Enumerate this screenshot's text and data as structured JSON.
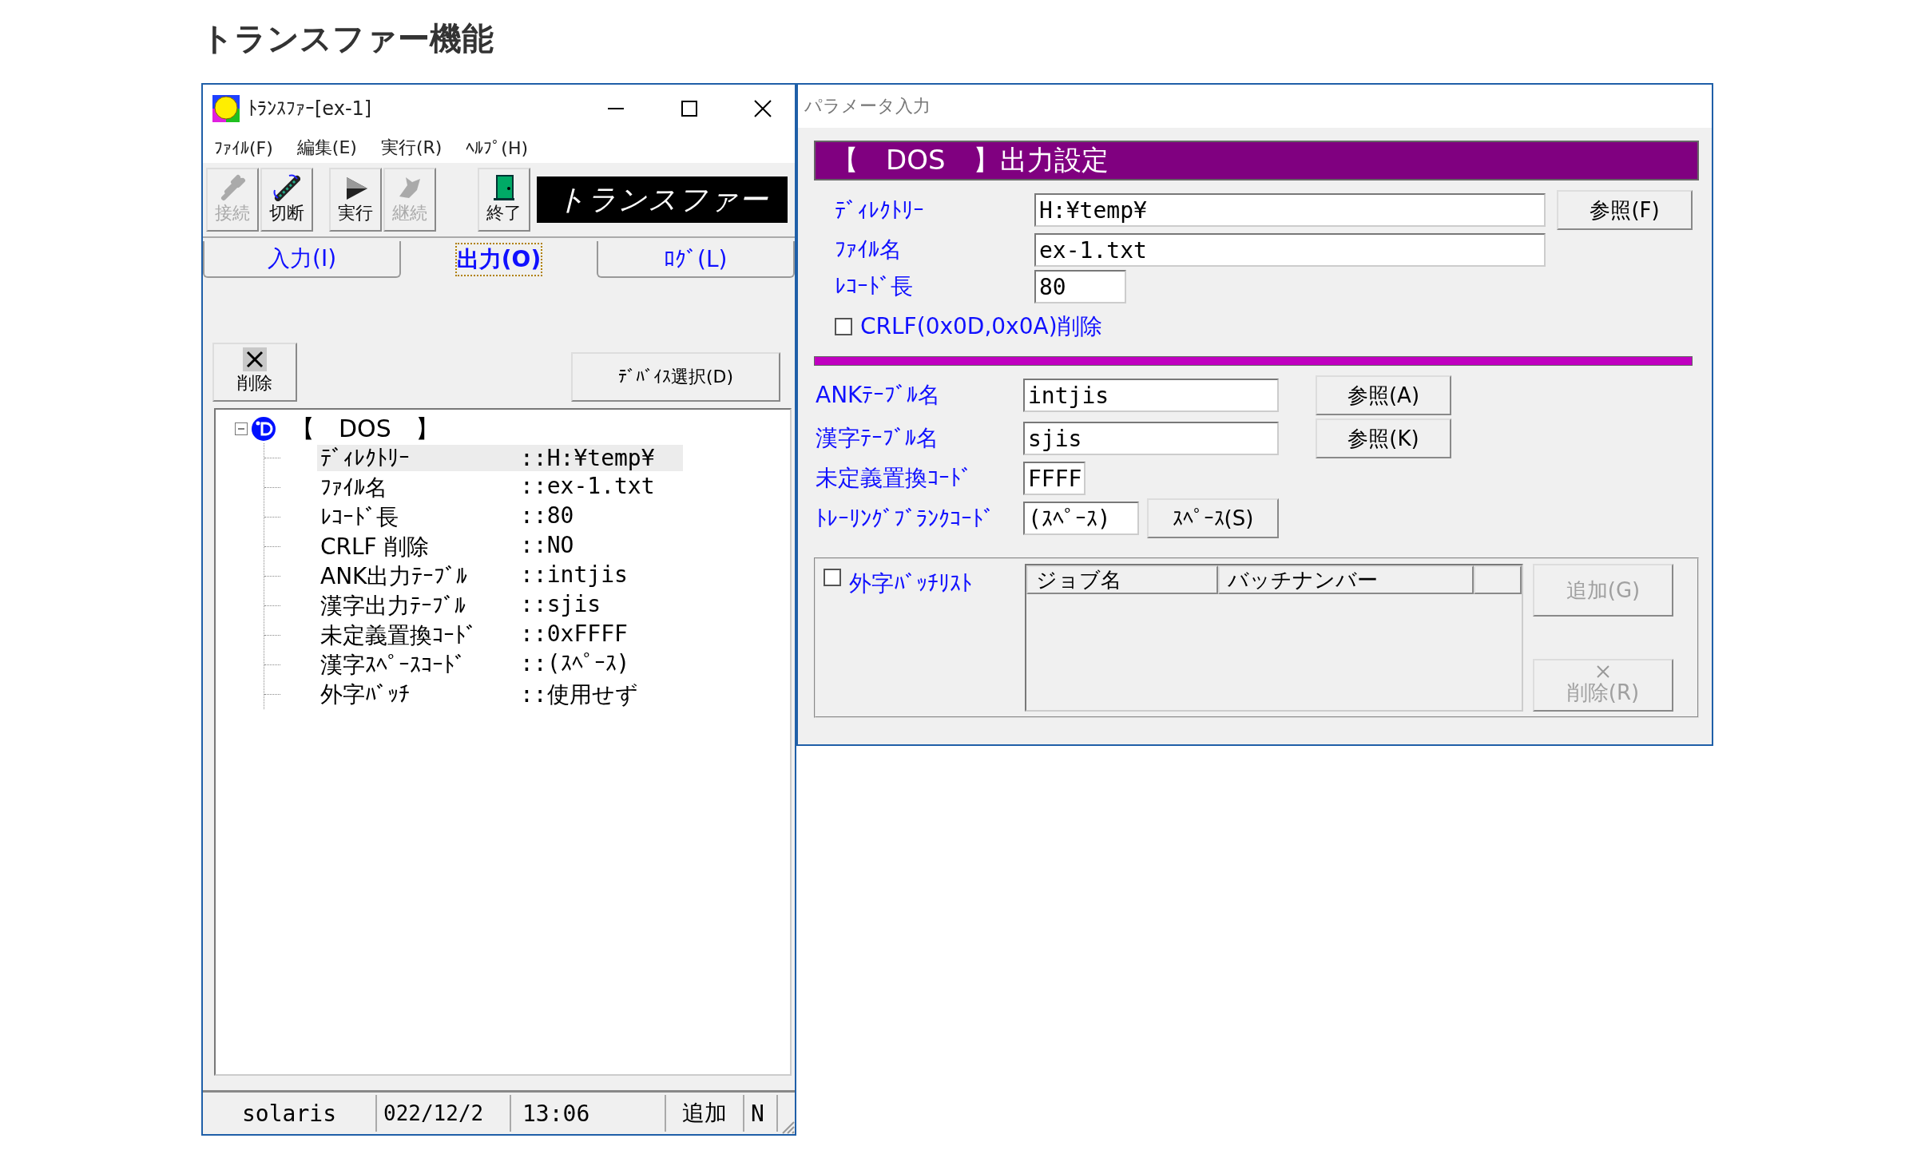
{
  "page_title": "トランスファー機能",
  "transfer_window": {
    "title": "ﾄﾗﾝｽﾌｧｰ[ex-1]",
    "menu": [
      "ﾌｧｲﾙ(F)",
      "編集(E)",
      "実行(R)",
      "ﾍﾙﾌﾟ(H)"
    ],
    "toolbar": [
      {
        "label": "接続",
        "kind": "plug",
        "disabled": true
      },
      {
        "label": "切断",
        "kind": "cable",
        "disabled": false
      },
      {
        "label": "実行",
        "kind": "play",
        "disabled": false
      },
      {
        "label": "継続",
        "kind": "hand",
        "disabled": true
      },
      {
        "label": "終了",
        "kind": "door",
        "disabled": false
      }
    ],
    "banner": "トランスファー",
    "tabs": [
      {
        "label": "入力(I)",
        "selected": false
      },
      {
        "label": "出力(O)",
        "selected": true
      },
      {
        "label": "ﾛｸﾞ(L)",
        "selected": false
      }
    ],
    "delete_button": "削除",
    "device_button": "ﾃﾞﾊﾞｲｽ選択(D)",
    "tree": {
      "label": "【　DOS　】",
      "expanded": true,
      "children": [
        {
          "label": "ﾃﾞｨﾚｸﾄﾘｰ",
          "value": "::H:¥temp¥",
          "selected": true
        },
        {
          "label": "ﾌｧｲﾙ名",
          "value": "::ex-1.txt",
          "selected": false
        },
        {
          "label": "ﾚｺｰﾄﾞ長",
          "value": "::80",
          "selected": false
        },
        {
          "label": "CRLF 削除",
          "value": "::NO",
          "selected": false
        },
        {
          "label": "ANK出力ﾃｰﾌﾞﾙ",
          "value": "::intjis",
          "selected": false
        },
        {
          "label": "漢字出力ﾃｰﾌﾞﾙ",
          "value": "::sjis",
          "selected": false
        },
        {
          "label": "未定義置換ｺｰﾄﾞ",
          "value": "::0xFFFF",
          "selected": false
        },
        {
          "label": "漢字ｽﾍﾟｰｽｺｰﾄﾞ",
          "value": "::(ｽﾍﾟｰｽ)",
          "selected": false
        },
        {
          "label": "外字ﾊﾞｯﾁ",
          "value": "::使用せず",
          "selected": false
        }
      ]
    },
    "status_bar": [
      "solaris",
      "022/12/2",
      "13:06",
      "追加",
      "N"
    ]
  },
  "parameter_panel": {
    "title": "パラメータ入力",
    "heading": "【　DOS　】出力設定",
    "file_fields": [
      {
        "label": "ﾃﾞｨﾚｸﾄﾘｰ",
        "value": "H:¥temp¥",
        "button": "参照(F)"
      },
      {
        "label": "ﾌｧｲﾙ名",
        "value": "ex-1.txt"
      },
      {
        "label": "ﾚｺｰﾄﾞ長",
        "value": "80"
      }
    ],
    "crlf": {
      "label": "CRLF(0x0D,0x0A)削除",
      "checked": false
    },
    "table_fields": [
      {
        "label": "ANKﾃｰﾌﾞﾙ名",
        "value": "intjis",
        "button": "参照(A)"
      },
      {
        "label": "漢字ﾃｰﾌﾞﾙ名",
        "value": "sjis",
        "button": "参照(K)"
      },
      {
        "label": "未定義置換ｺｰﾄﾞ",
        "value": "FFFF"
      },
      {
        "label": "ﾄﾚｰﾘﾝｸﾞﾌﾞﾗﾝｸｺｰﾄﾞ",
        "value": "(ｽﾍﾟｰｽ)",
        "button": "ｽﾍﾟｰｽ(S)"
      }
    ],
    "gaiji": {
      "label": "外字ﾊﾞｯﾁﾘｽﾄ",
      "checked": false,
      "columns": [
        "ジョブ名",
        "バッチナンバー"
      ],
      "buttons": [
        {
          "label": "追加(G)",
          "disabled": true
        },
        {
          "label": "削除(R)",
          "disabled": true
        }
      ]
    }
  }
}
